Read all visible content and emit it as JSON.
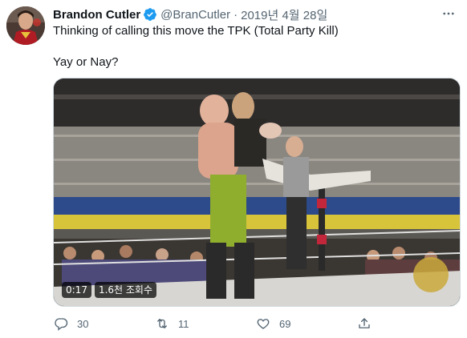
{
  "tweet": {
    "display_name": "Brandon Cutler",
    "handle": "@BranCutler",
    "separator": "·",
    "date": "2019년 4월 28일",
    "text_line1": "Thinking of calling this move the TPK (Total Party Kill)",
    "text_line2": "Yay or Nay?",
    "more_icon": "more-horizontal-icon",
    "verified_icon": "verified-badge-icon",
    "verified_color": "#1d9bf0"
  },
  "media": {
    "duration": "0:17",
    "views": "1.6천 조회수"
  },
  "actions": {
    "reply_count": "30",
    "retweet_count": "11",
    "like_count": "69",
    "icons": [
      "reply-icon",
      "retweet-icon",
      "like-icon",
      "share-icon"
    ],
    "color": "#536471"
  }
}
